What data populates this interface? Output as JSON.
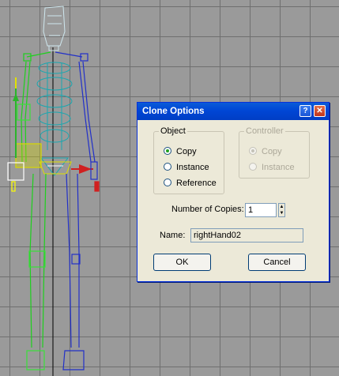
{
  "dialog": {
    "title": "Clone Options",
    "help_button": "?",
    "close_button": "✕",
    "object_group": {
      "legend": "Object",
      "options": [
        "Copy",
        "Instance",
        "Reference"
      ],
      "selected": "Copy"
    },
    "controller_group": {
      "legend": "Controller",
      "options": [
        "Copy",
        "Instance"
      ],
      "selected": "Copy",
      "enabled": false
    },
    "copies": {
      "label": "Number of Copies:",
      "value": "1"
    },
    "name": {
      "label": "Name:",
      "value": "rightHand02"
    },
    "ok_label": "OK",
    "cancel_label": "Cancel"
  },
  "viewport": {
    "background": "#9a9a9a",
    "grid_color": "#6f6f6f",
    "colors": {
      "left_side": "#1ed01e",
      "right_side": "#2230c8",
      "spine": "#18a7b0",
      "head": "#cfe7ee",
      "selection": "#ffffff",
      "helper": "#d8d800"
    }
  }
}
